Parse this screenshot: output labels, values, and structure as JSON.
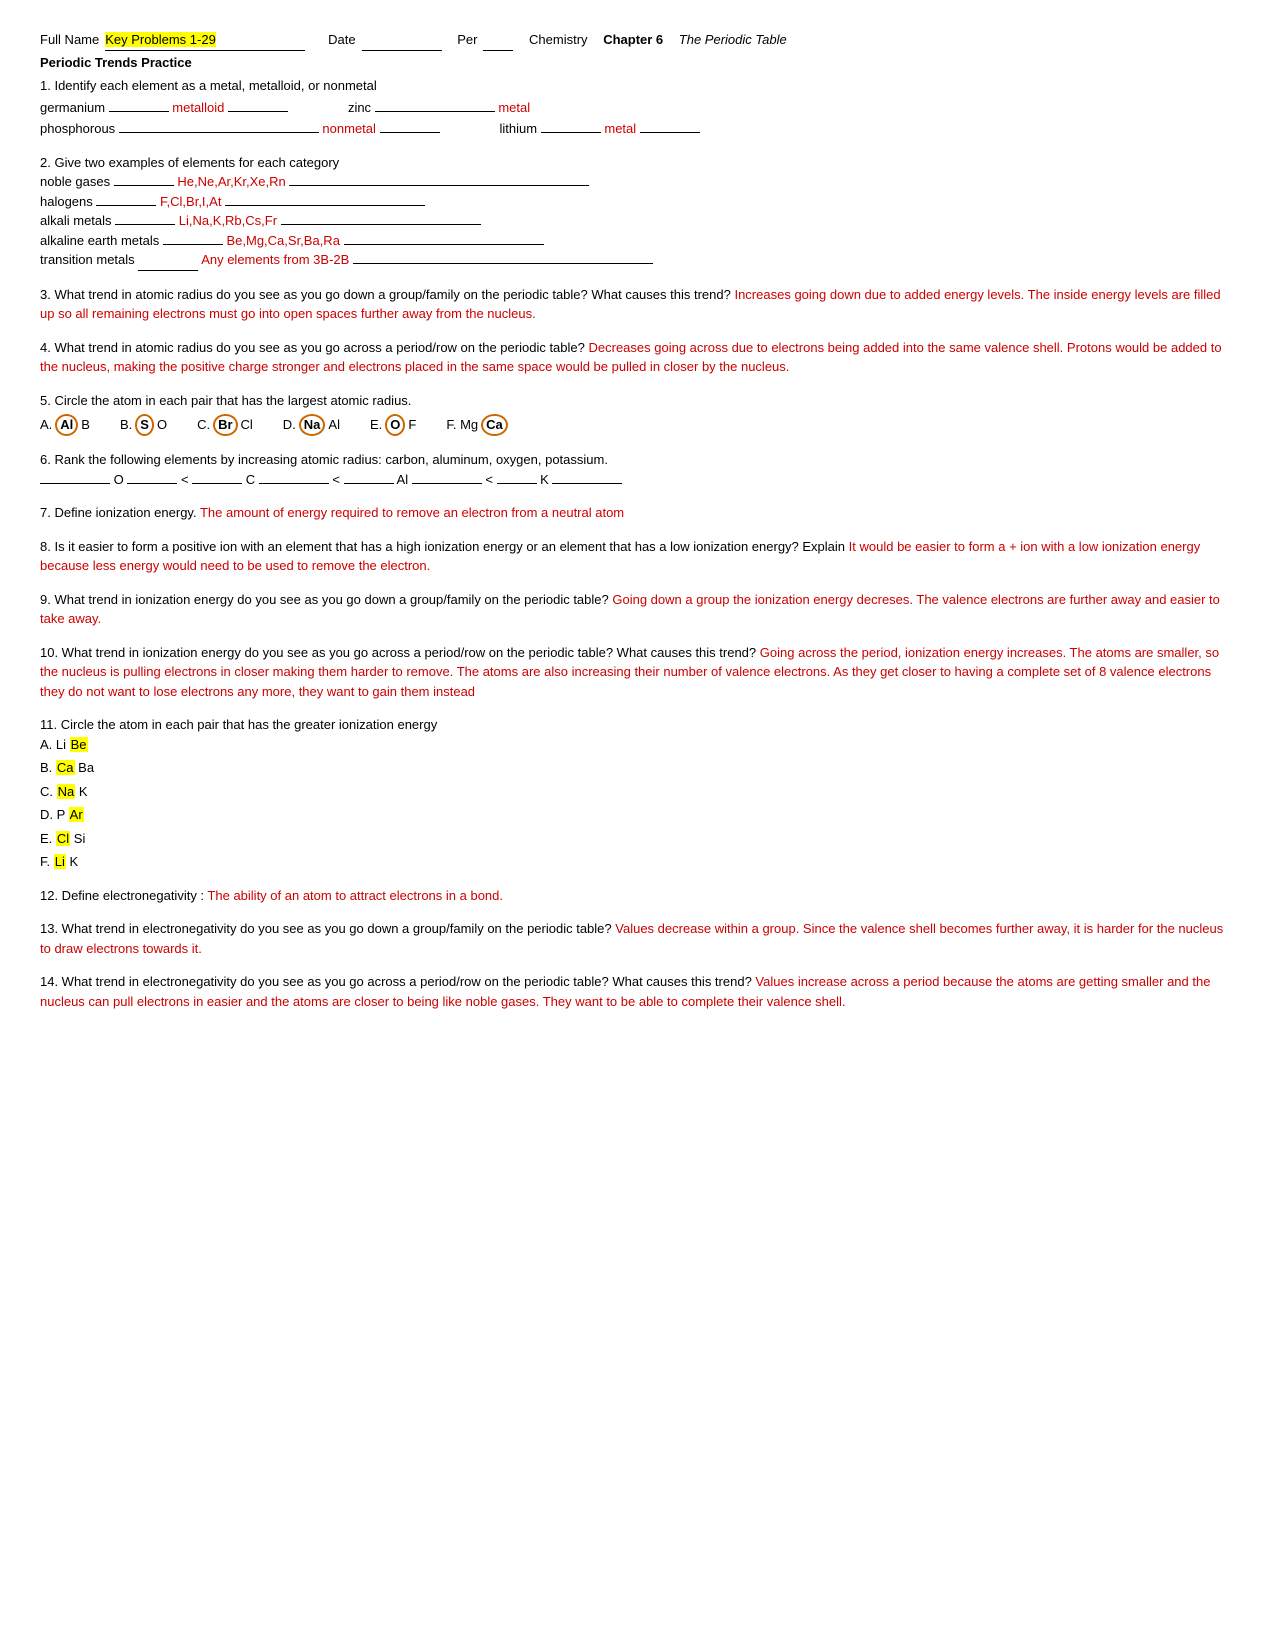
{
  "header": {
    "full_name_label": "Full Name",
    "name_value": "Key Problems 1-29",
    "date_label": "Date",
    "per_label": "Per",
    "course_label": "Chemistry",
    "chapter_label": "Chapter 6",
    "chapter_italic": "The Periodic Table"
  },
  "section_title": "Periodic Trends Practice",
  "q1": {
    "text": "1. Identify each element as a metal, metalloid, or nonmetal",
    "germanium_label": "germanium",
    "germanium_answer": "metalloid",
    "zinc_label": "zinc",
    "zinc_answer": "metal",
    "phosphorous_label": "phosphorous",
    "phosphorous_answer": "nonmetal",
    "lithium_label": "lithium",
    "lithium_answer": "metal"
  },
  "q2": {
    "text": "2. Give two examples of elements for each category",
    "noble_gases_label": "noble gases",
    "noble_gases_answer": "He,Ne,Ar,Kr,Xe,Rn",
    "halogens_label": "halogens",
    "halogens_answer": "F,Cl,Br,I,At",
    "alkali_metals_label": "alkali metals",
    "alkali_metals_answer": "Li,Na,K,Rb,Cs,Fr",
    "alkaline_label": "alkaline earth metals",
    "alkaline_answer": "Be,Mg,Ca,Sr,Ba,Ra",
    "transition_label": "transition metals",
    "transition_answer": "Any elements from 3B-2B"
  },
  "q3": {
    "question": "3. What trend in atomic radius do you see as you go down a group/family on the periodic table? What causes this trend?",
    "answer": "Increases going down due to added energy levels.  The inside energy levels are filled up so all remaining electrons must go into open spaces further away from the nucleus."
  },
  "q4": {
    "question": "4. What trend in atomic radius do you see as you go across a period/row on the periodic table?",
    "answer": "Decreases going across due to electrons being added into the same valence shell.  Protons would be added to the nucleus, making the positive charge stronger and electrons placed in the same space would be pulled in closer by the nucleus."
  },
  "q5": {
    "text": "5. Circle the atom in each pair that has the largest atomic radius.",
    "pairs": [
      {
        "label": "A.",
        "left": "Al",
        "right": "B",
        "circled": "Al",
        "circle_left": true
      },
      {
        "label": "B.",
        "left": "S",
        "right": "O",
        "circled": "S",
        "circle_left": true
      },
      {
        "label": "C.",
        "left": "Br",
        "right": "Cl",
        "circled": "Br",
        "circle_left": true
      },
      {
        "label": "D.",
        "left": "Na",
        "right": "Al",
        "circled": "Na",
        "circle_left": true
      },
      {
        "label": "E.",
        "left": "O",
        "right": "F",
        "circled": "O",
        "circle_left": true
      },
      {
        "label": "F.",
        "left": "Mg",
        "right": "Ca",
        "circled": "Ca",
        "circle_left": false
      }
    ]
  },
  "q6": {
    "question": "6. Rank the following elements by increasing atomic radius: carbon, aluminum, oxygen, potassium.",
    "answer": "__________O_________<__________C__________<_________Al__________<________K___________"
  },
  "q7": {
    "question": "7. Define ionization energy.",
    "answer": "The amount of energy required to remove an electron from a neutral atom"
  },
  "q8": {
    "question": "8. Is it easier to form a positive ion with an element that has a high ionization energy or an element that has a low ionization energy? Explain",
    "answer": "It would be easier to form a + ion with a low ionization energy because less energy would need to be used to remove the electron."
  },
  "q9": {
    "question": "9. What trend in ionization energy do you see as you go down a group/family on the periodic table?",
    "answer": "Going down a group the ionization energy decreses.  The valence electrons are further away and easier to take away."
  },
  "q10": {
    "question": "10. What trend in ionization energy do you see as you go across a period/row on the periodic table? What causes this trend?",
    "answer": "Going across the period, ionization energy increases.  The atoms are smaller, so the nucleus is pulling electrons in closer making them harder to remove.  The atoms are also increasing their number of valence electrons.  As they get closer to having a complete set of 8 valence electrons they do not want to lose electrons any more, they want to gain them instead"
  },
  "q11": {
    "text": "11. Circle the atom in each pair that has the greater ionization energy",
    "pairs": [
      {
        "label": "A. Li",
        "circled": "Be",
        "rest": ""
      },
      {
        "label": "B.",
        "circled": "Ca",
        "rest": "Ba"
      },
      {
        "label": "C.",
        "circled": "Na",
        "rest": "K"
      },
      {
        "label": "D. P",
        "circled": "Ar",
        "rest": ""
      },
      {
        "label": "E.",
        "circled": "Cl",
        "rest": "Si"
      },
      {
        "label": "F.",
        "circled": "Li",
        "rest": "K"
      }
    ]
  },
  "q12": {
    "question": "12. Define electronegativity :",
    "answer": "The ability of an atom to attract electrons in a bond."
  },
  "q13": {
    "question": "13. What trend in electronegativity do you see as you go down a group/family on the periodic table?",
    "answer": "Values decrease within a group.  Since the valence shell becomes further away, it is harder for the nucleus to draw electrons towards it."
  },
  "q14": {
    "question": "14. What trend in electronegativity do you see as you go across a period/row on the periodic table? What causes this trend?",
    "answer": "Values increase across a period because the atoms are getting smaller and the nucleus can pull electrons in easier and the atoms are closer to being like noble gases.  They want to be able to complete their valence shell."
  }
}
